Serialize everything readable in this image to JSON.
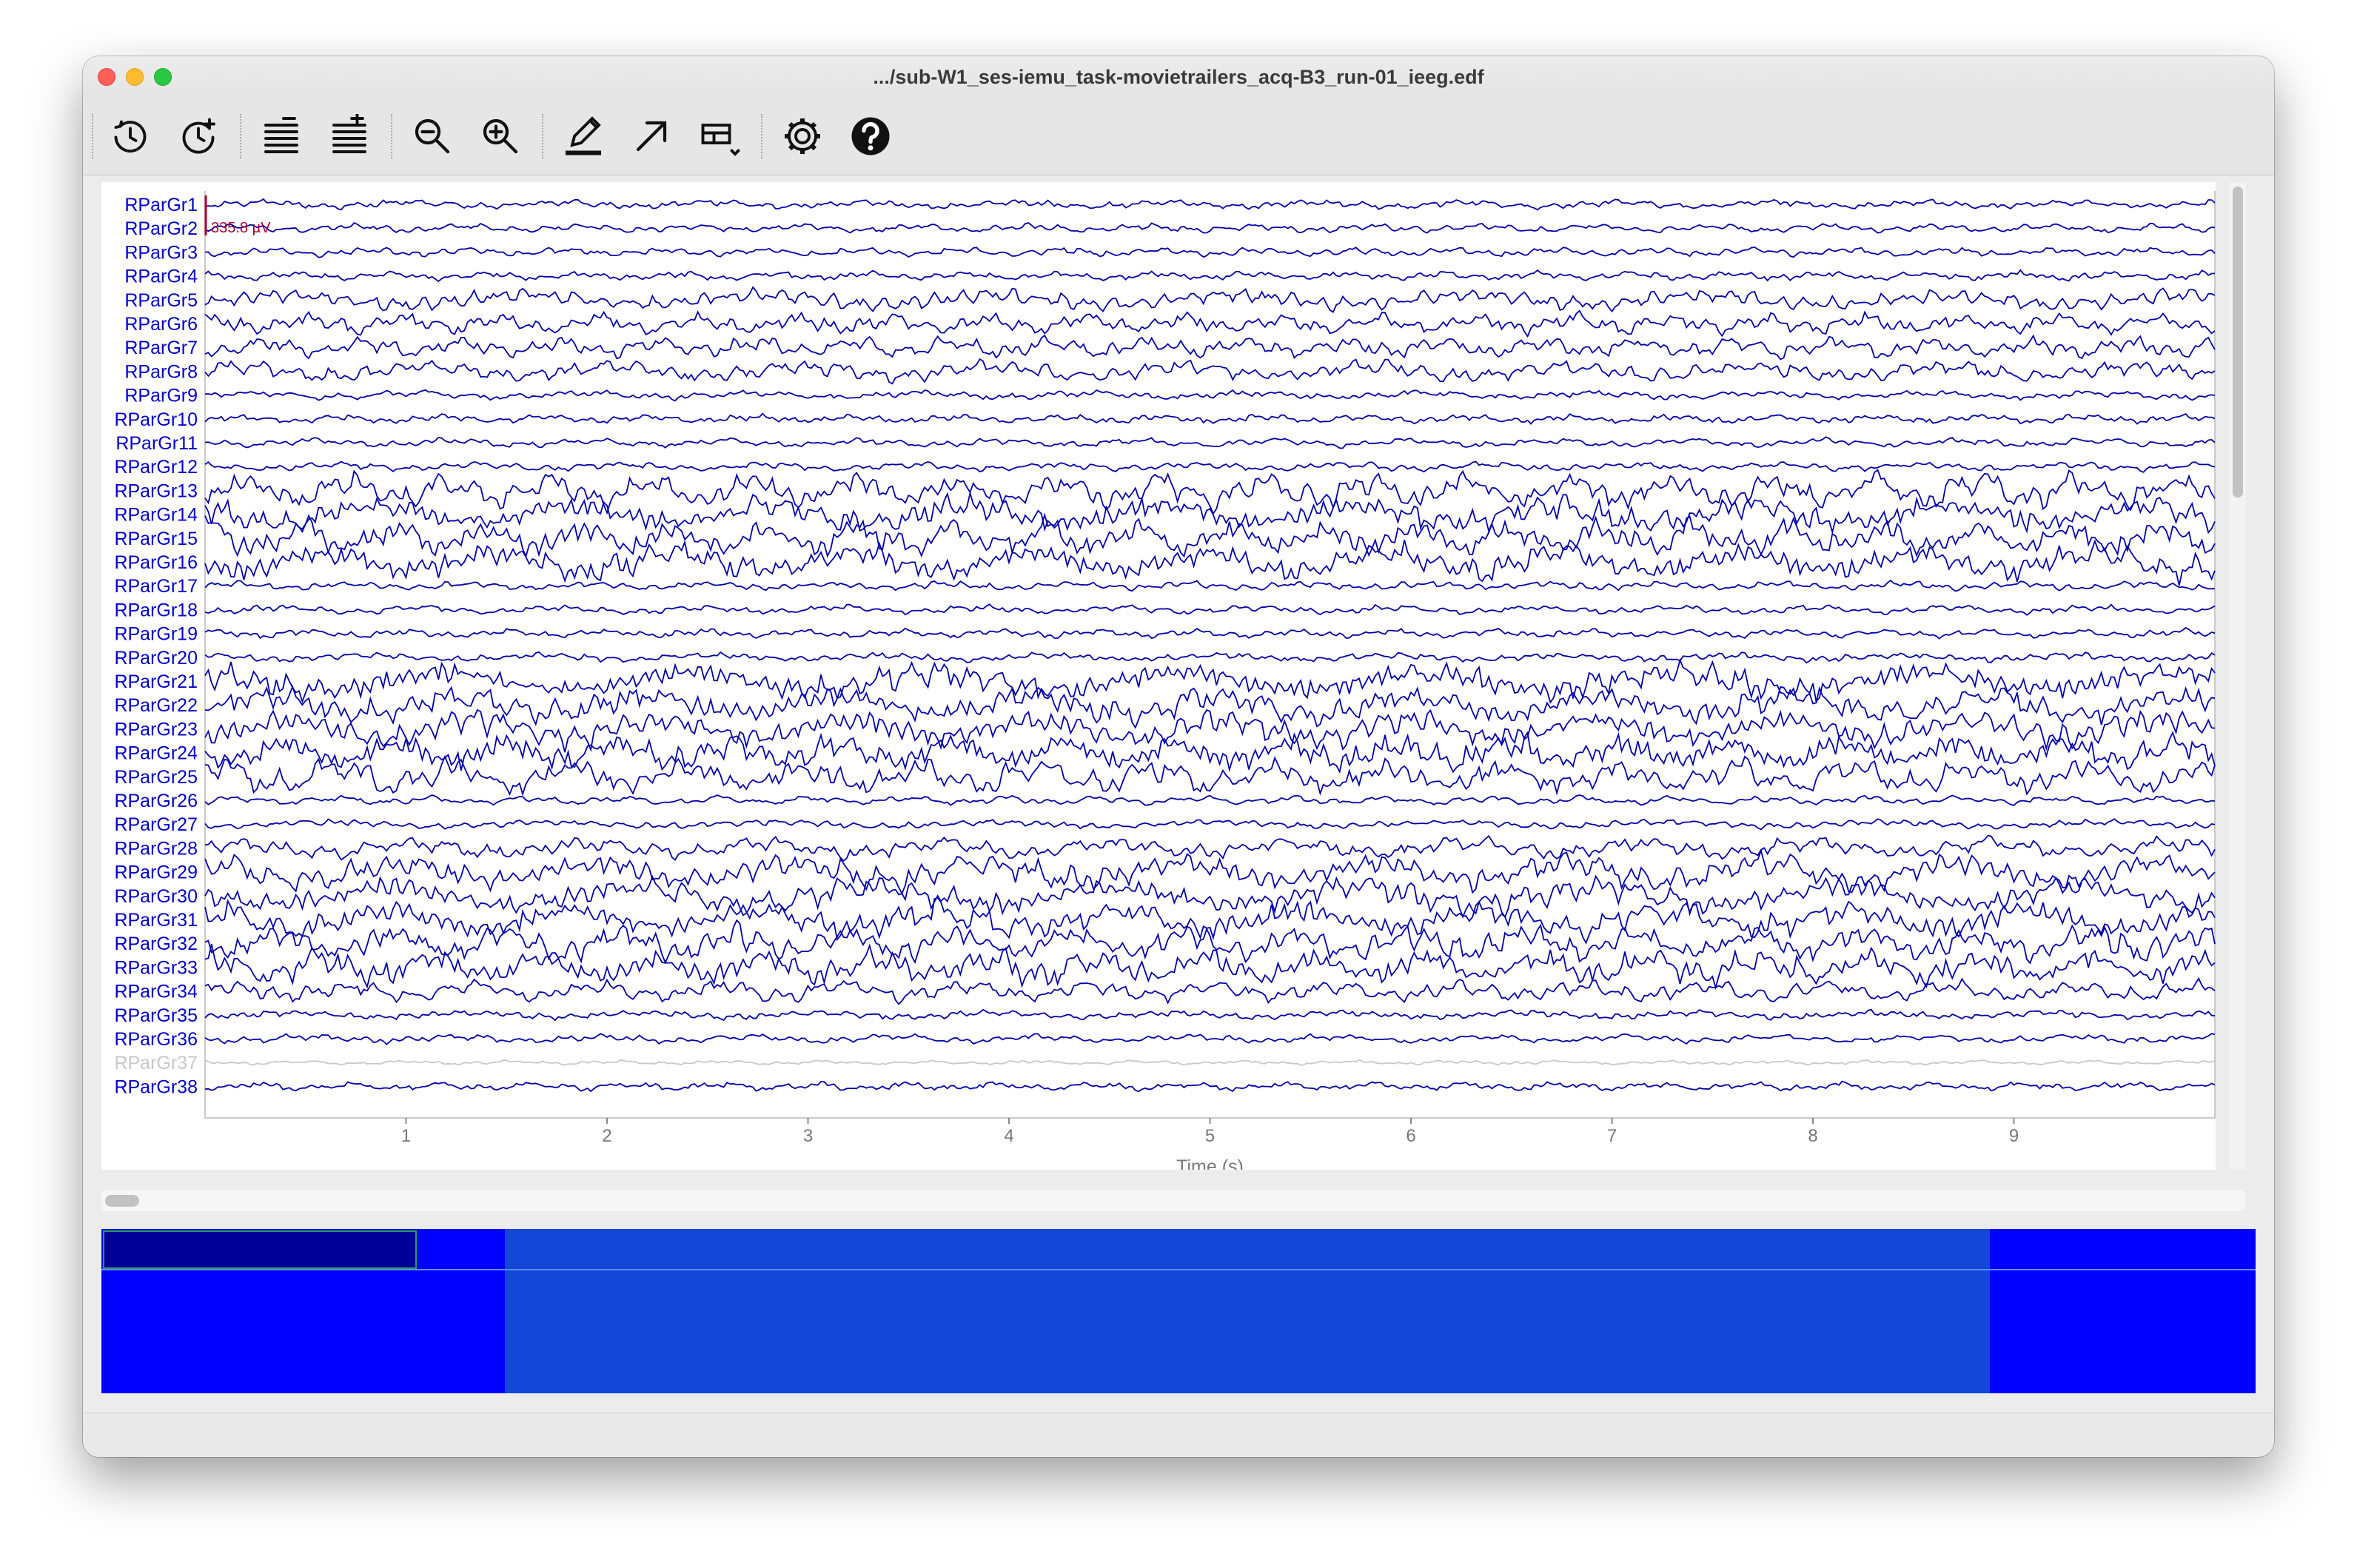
{
  "window": {
    "title": ".../sub-W1_ses-iemu_task-movietrailers_acq-B3_run-01_ieeg.edf"
  },
  "toolbar": {
    "buttons": [
      {
        "name": "time-back-icon"
      },
      {
        "name": "time-forward-icon"
      },
      {
        "name": "fewer-channels-icon"
      },
      {
        "name": "more-channels-icon"
      },
      {
        "name": "zoom-out-icon"
      },
      {
        "name": "zoom-in-icon"
      },
      {
        "name": "annotate-pen-icon"
      },
      {
        "name": "arrow-icon"
      },
      {
        "name": "layout-menu-icon"
      },
      {
        "name": "settings-gear-icon"
      },
      {
        "name": "help-icon"
      }
    ]
  },
  "chart_data": {
    "type": "line",
    "xlabel": "Time (s)",
    "xlim": [
      0,
      10
    ],
    "x_ticks": [
      "1",
      "2",
      "3",
      "4",
      "5",
      "6",
      "7",
      "8",
      "9"
    ],
    "scale_label": "335.8 µV",
    "channels": [
      "RParGr1",
      "RParGr2",
      "RParGr3",
      "RParGr4",
      "RParGr5",
      "RParGr6",
      "RParGr7",
      "RParGr8",
      "RParGr9",
      "RParGr10",
      "RParGr11",
      "RParGr12",
      "RParGr13",
      "RParGr14",
      "RParGr15",
      "RParGr16",
      "RParGr17",
      "RParGr18",
      "RParGr19",
      "RParGr20",
      "RParGr21",
      "RParGr22",
      "RParGr23",
      "RParGr24",
      "RParGr25",
      "RParGr26",
      "RParGr27",
      "RParGr28",
      "RParGr29",
      "RParGr30",
      "RParGr31",
      "RParGr32",
      "RParGr33",
      "RParGr34",
      "RParGr35",
      "RParGr36",
      "RParGr37",
      "RParGr38"
    ],
    "bad_channels": [
      "RParGr37"
    ],
    "trace_color": "#0000aa",
    "bad_color": "#c8c8c8",
    "label_color": "#0000cc"
  }
}
